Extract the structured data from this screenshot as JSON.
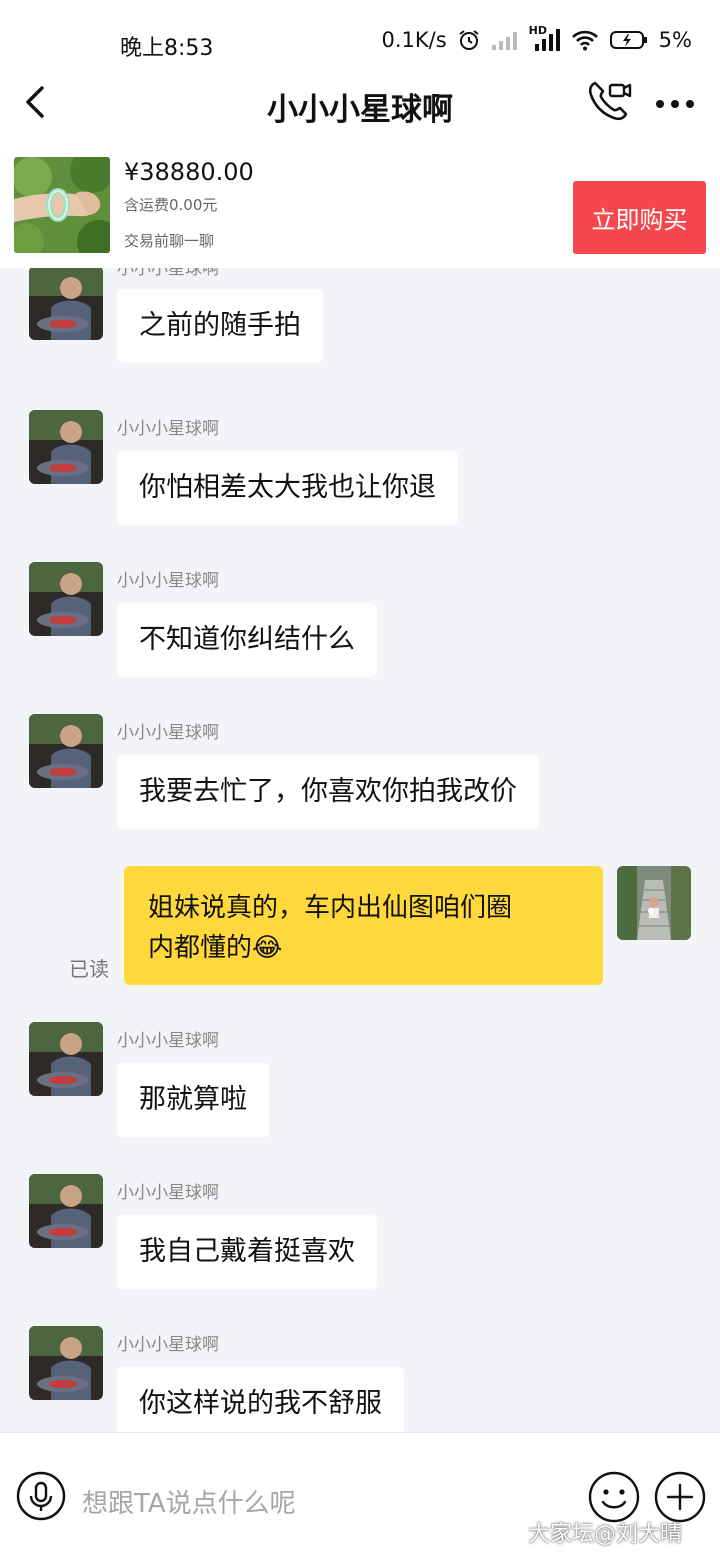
{
  "status_bar": {
    "time": "晚上8:53",
    "network_speed": "0.1K/s",
    "network_type": "HD",
    "battery": "5%",
    "icons": [
      "alarm-icon",
      "signal-icon",
      "wifi-icon",
      "battery-icon"
    ]
  },
  "header": {
    "title": "小小小星球啊",
    "back_icon": "chevron-left-icon",
    "call_icon": "phone-video-icon",
    "more_icon": "more-dots-icon"
  },
  "product": {
    "price": "¥38880.00",
    "shipping": "含运费0.00元",
    "note": "交易前聊一聊",
    "buy_label": "立即购买",
    "buy_color": "#f4484d"
  },
  "messages": [
    {
      "sender": "小小小星球啊",
      "text": "之前的随手拍"
    },
    {
      "sender": "小小小星球啊",
      "text": "你怕相差太大我也让你退"
    },
    {
      "sender": "小小小星球啊",
      "text": "不知道你纠结什么"
    },
    {
      "sender": "小小小星球啊",
      "text": "我要去忙了，你喜欢你拍我改价"
    },
    {
      "sender": "小小小星球啊",
      "text": "那就算啦"
    },
    {
      "sender": "小小小星球啊",
      "text": "我自己戴着挺喜欢"
    },
    {
      "sender": "小小小星球啊",
      "text": "你这样说的我不舒服"
    }
  ],
  "my_message": {
    "line1": "姐妹说真的，车内出仙图咱们圈",
    "line2": "内都懂的😂",
    "read_status": "已读",
    "bubble_color": "#ffd93c"
  },
  "input": {
    "placeholder": "想跟TA说点什么呢",
    "voice_icon": "microphone-icon",
    "emoji_icon": "emoji-icon",
    "plus_icon": "plus-icon"
  },
  "watermark": "大家坛@刘大晴"
}
